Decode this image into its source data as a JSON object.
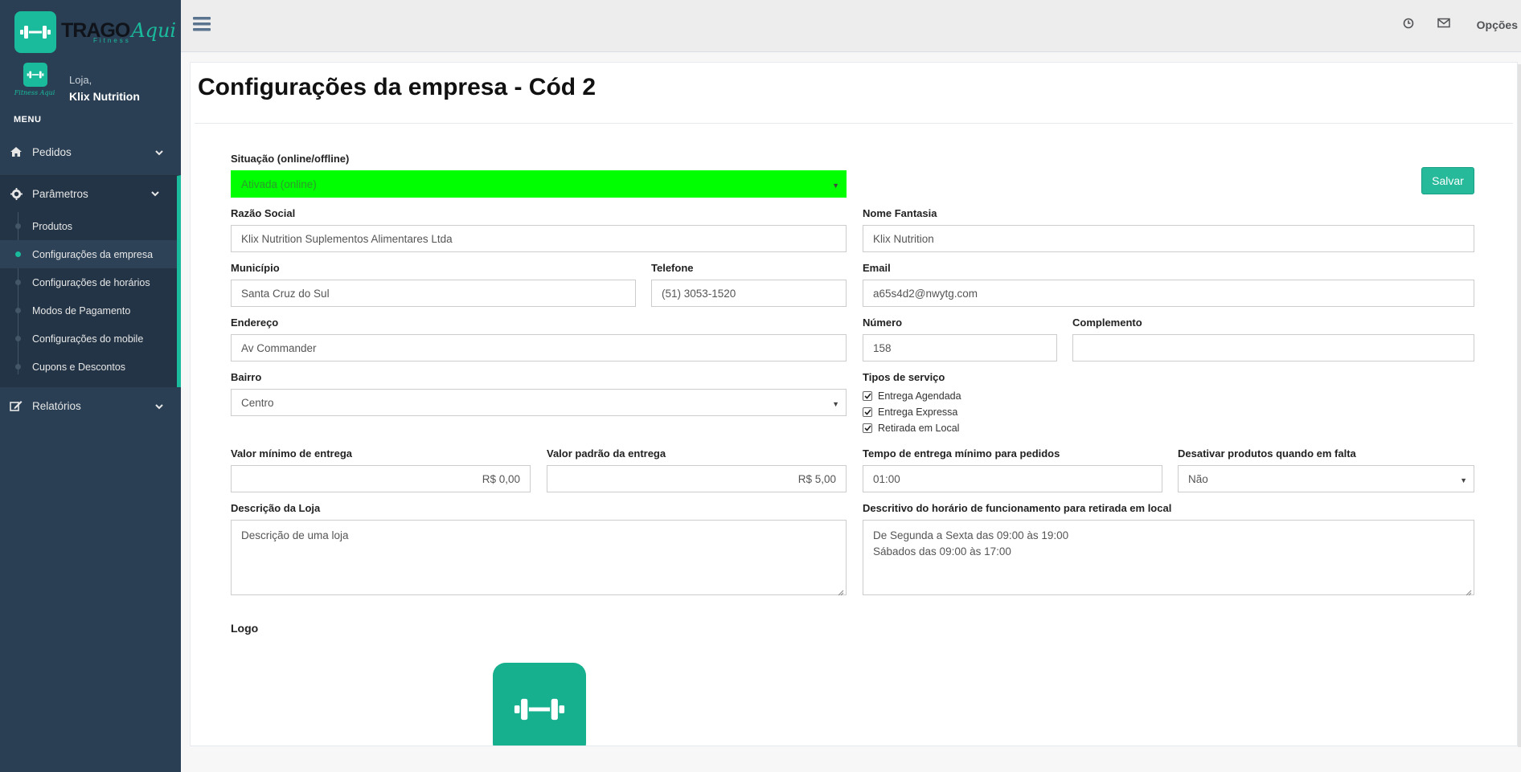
{
  "brand": {
    "name_main": "TRAGO",
    "name_script": "Aqui",
    "tagline": "Fitness",
    "accent_color": "#1abb9c",
    "sidebar_color": "#2a3f54"
  },
  "profile": {
    "greeting": "Loja,",
    "name": "Klix Nutrition",
    "mini_logo_text": "Fitness Aqui"
  },
  "menu": {
    "title": "MENU",
    "pedidos": "Pedidos",
    "parametros": "Parâmetros",
    "relatorios": "Relatórios",
    "sub_items": [
      "Produtos",
      "Configurações da empresa",
      "Configurações de horários",
      "Modos de Pagamento",
      "Configurações do mobile",
      "Cupons e Descontos"
    ]
  },
  "topbar": {
    "options_label": "Opções"
  },
  "page": {
    "title": "Configurações da empresa - Cód 2"
  },
  "form": {
    "situacao": {
      "label": "Situação (online/offline)",
      "value": "Ativada (online)",
      "color": "#00ff00"
    },
    "save_label": "Salvar",
    "razao_social": {
      "label": "Razão Social",
      "value": "Klix Nutrition Suplementos Alimentares Ltda"
    },
    "nome_fantasia": {
      "label": "Nome Fantasia",
      "value": "Klix Nutrition"
    },
    "municipio": {
      "label": "Município",
      "value": "Santa Cruz do Sul"
    },
    "telefone": {
      "label": "Telefone",
      "value": "(51) 3053-1520"
    },
    "email": {
      "label": "Email",
      "value": "a65s4d2@nwytg.com"
    },
    "endereco": {
      "label": "Endereço",
      "value": "Av Commander"
    },
    "numero": {
      "label": "Número",
      "value": "158"
    },
    "complemento": {
      "label": "Complemento",
      "value": ""
    },
    "bairro": {
      "label": "Bairro",
      "value": "Centro"
    },
    "tipos_servico": {
      "label": "Tipos de serviço",
      "options": [
        {
          "label": "Entrega Agendada",
          "checked": true
        },
        {
          "label": "Entrega Expressa",
          "checked": true
        },
        {
          "label": "Retirada em Local",
          "checked": true
        }
      ]
    },
    "valor_minimo": {
      "label": "Valor mínimo de entrega",
      "value": "R$ 0,00"
    },
    "valor_padrao": {
      "label": "Valor padrão da entrega",
      "value": "R$ 5,00"
    },
    "tempo_entrega": {
      "label": "Tempo de entrega mínimo para pedidos",
      "value": "01:00"
    },
    "desativar_produtos": {
      "label": "Desativar produtos quando em falta",
      "value": "Não"
    },
    "descricao_loja": {
      "label": "Descrição da Loja",
      "value": "Descrição de uma loja"
    },
    "descritivo_horario": {
      "label": "Descritivo do horário de funcionamento para retirada em local",
      "line1": "De Segunda a Sexta das 09:00 às 19:00",
      "line2": "Sábados das 09:00 às 17:00"
    },
    "logo_label": "Logo"
  }
}
